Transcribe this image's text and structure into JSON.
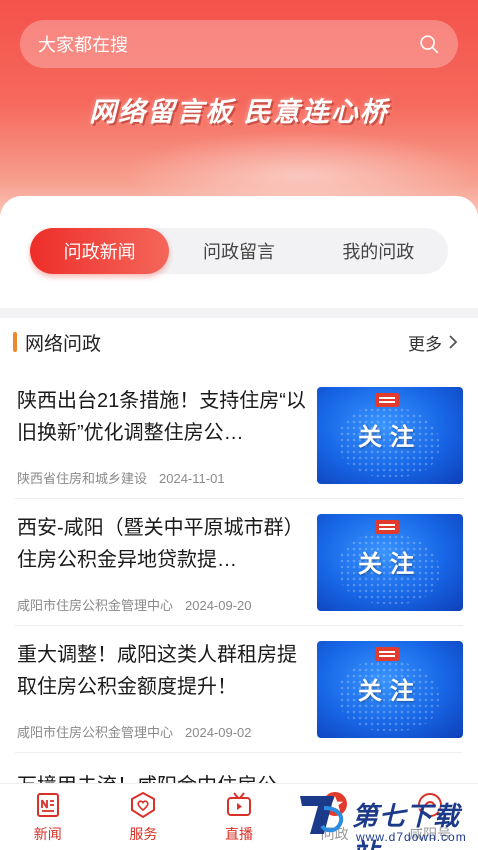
{
  "search": {
    "placeholder": "大家都在搜"
  },
  "hero": {
    "slogan": "网络留言板 民意连心桥"
  },
  "tabs": [
    {
      "label": "问政新闻",
      "active": true
    },
    {
      "label": "问政留言",
      "active": false
    },
    {
      "label": "我的问政",
      "active": false
    }
  ],
  "section": {
    "title": "网络问政",
    "more_label": "更多"
  },
  "news": [
    {
      "title": "陕西出台21条措施！支持住房“以旧换新”优化调整住房公…",
      "source": "陕西省住房和城乡建设",
      "date": "2024-11-01",
      "thumb_text": "关注"
    },
    {
      "title": "西安-咸阳（暨关中平原城市群）住房公积金异地贷款提…",
      "source": "咸阳市住房公积金管理中心",
      "date": "2024-09-20",
      "thumb_text": "关注"
    },
    {
      "title": "重大调整！咸阳这类人群租房提取住房公积金额度提升！",
      "source": "咸阳市住房公积金管理中心",
      "date": "2024-09-02",
      "thumb_text": "关注"
    }
  ],
  "partial_news": {
    "title": "万境甲去流！咸阳金中住房公"
  },
  "bottom_nav": [
    {
      "label": "新闻",
      "icon": "news-icon"
    },
    {
      "label": "服务",
      "icon": "service-icon"
    },
    {
      "label": "直播",
      "icon": "live-tv-icon"
    },
    {
      "label": "问政",
      "icon": "star-icon"
    },
    {
      "label": "咸阳号",
      "icon": "account-icon"
    }
  ],
  "watermark": {
    "text": "第七下载站",
    "url": "www.d7down.com"
  },
  "colors": {
    "accent": "#ee2e2a",
    "section_bar": "#f0882c",
    "thumb_blue": "#1766e6"
  }
}
